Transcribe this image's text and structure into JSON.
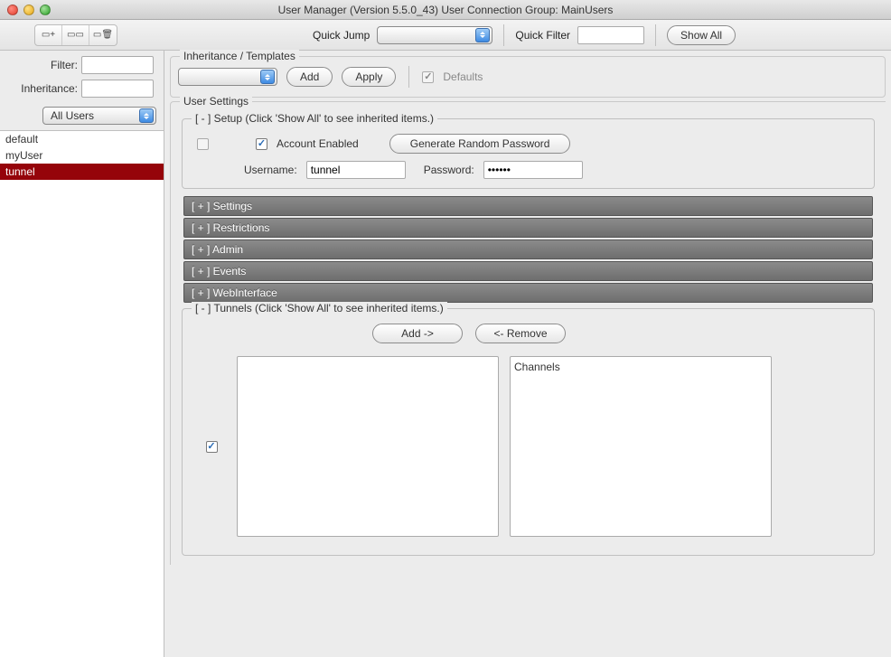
{
  "window": {
    "title": "User Manager (Version 5.5.0_43) User Connection Group: MainUsers"
  },
  "toolbar": {
    "quick_jump_label": "Quick Jump",
    "quick_filter_label": "Quick Filter",
    "show_all_label": "Show All"
  },
  "left": {
    "filter_label": "Filter:",
    "inheritance_label": "Inheritance:",
    "filter_value": "",
    "inheritance_value": "",
    "dropdown_value": "All Users",
    "users": [
      "default",
      "myUser",
      "tunnel"
    ],
    "selected_user": "tunnel"
  },
  "inheritance_box": {
    "legend": "Inheritance / Templates",
    "add_label": "Add",
    "apply_label": "Apply",
    "defaults_label": "Defaults"
  },
  "user_settings": {
    "legend": "User Settings",
    "setup": {
      "legend": "[ - ] Setup (Click 'Show All' to see inherited items.)",
      "account_enabled_label": "Account Enabled",
      "account_enabled_checked": true,
      "gen_password_label": "Generate Random Password",
      "username_label": "Username:",
      "username_value": "tunnel",
      "password_label": "Password:",
      "password_value": "••••••"
    },
    "collapsed": {
      "settings": "[ + ] Settings",
      "restrictions": "[ + ] Restrictions",
      "admin": "[ + ] Admin",
      "events": "[ + ] Events",
      "webinterface": "[ + ] WebInterface"
    },
    "tunnels": {
      "legend": "[ - ] Tunnels (Click 'Show All' to see inherited items.)",
      "add_label": "Add ->",
      "remove_label": "<- Remove",
      "channels_label": "Channels"
    }
  }
}
